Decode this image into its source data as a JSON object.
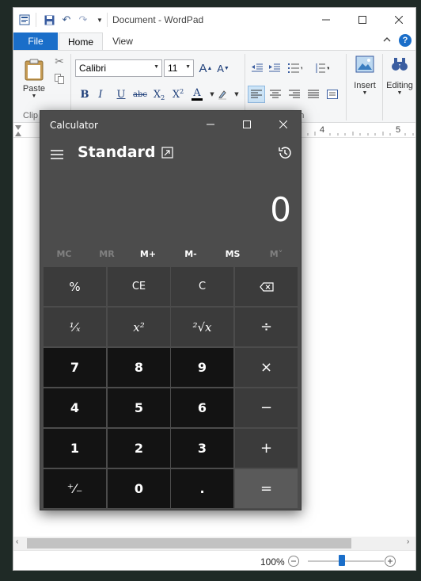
{
  "wordpad": {
    "title": "Document - WordPad",
    "tabs": [
      "File",
      "Home",
      "View"
    ],
    "font": {
      "name": "Calibri",
      "size": "11"
    },
    "ribbon": {
      "paste_label": "Paste",
      "clipboard_group": "Clip",
      "paragraph_group": "aph",
      "insert_label": "Insert",
      "editing_label": "Editing"
    },
    "ruler": {
      "mark_4": "4",
      "mark_5": "5"
    },
    "status": {
      "zoom": "100%"
    }
  },
  "calculator": {
    "title": "Calculator",
    "mode": "Standard",
    "display": "0",
    "memory": [
      "MC",
      "MR",
      "M+",
      "M-",
      "MS",
      "M˅"
    ],
    "keys": {
      "percent": "%",
      "ce": "CE",
      "c": "C",
      "backspace": "⌫",
      "reciprocal": "¹⁄ₓ",
      "square": "x²",
      "sqrt": "²√x",
      "divide": "÷",
      "n7": "7",
      "n8": "8",
      "n9": "9",
      "multiply": "×",
      "n4": "4",
      "n5": "5",
      "n6": "6",
      "minus": "−",
      "n1": "1",
      "n2": "2",
      "n3": "3",
      "plus": "+",
      "negate": "⁺⁄₋",
      "n0": "0",
      "decimal": ".",
      "equals": "="
    }
  },
  "colors": {
    "accent": "#1a6ec9",
    "calc_bg": "#4c4c4c",
    "calc_num_key": "#131313",
    "calc_fn_key": "#3b3b3b"
  }
}
